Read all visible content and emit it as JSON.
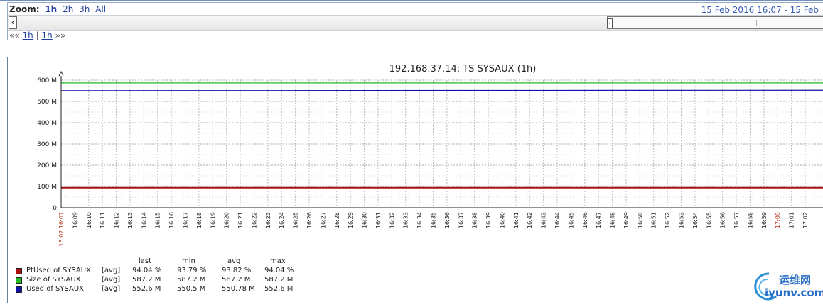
{
  "filter": {
    "zoom_label": "Zoom:",
    "zoom_options": [
      "1h",
      "2h",
      "3h",
      "All"
    ],
    "range_text": "15 Feb 2016 16:07  -  15 Feb",
    "nav_prev": "««",
    "nav_left": "1h",
    "nav_sep": "|",
    "nav_right": "1h",
    "nav_next": "»»",
    "scroll_left_glyph": "‹",
    "thumb_glyph": "‹",
    "thumb_grip": "|||"
  },
  "legend": {
    "headers": [
      "last",
      "min",
      "avg",
      "max"
    ],
    "rows": [
      {
        "name": "PtUsed of SYSAUX",
        "func": "[avg]",
        "last": "94.04 %",
        "min": "93.79 %",
        "avg": "93.82 %",
        "max": "94.04 %",
        "color": "#aa1111"
      },
      {
        "name": "Size of SYSAUX",
        "func": "[avg]",
        "last": "587.2 M",
        "min": "587.2 M",
        "avg": "587.2 M",
        "max": "587.2 M",
        "color": "#22bb22"
      },
      {
        "name": "Used of SYSAUX",
        "func": "[avg]",
        "last": "552.6 M",
        "min": "550.5 M",
        "avg": "550.78 M",
        "max": "552.6 M",
        "color": "#1111aa"
      }
    ]
  },
  "watermark": {
    "cn": "运维网",
    "en": "iyunv.com"
  },
  "chart_data": {
    "type": "line",
    "title": "192.168.37.14: TS SYSAUX (1h)",
    "xlabel": "",
    "ylabel": "",
    "ylim": [
      0,
      600
    ],
    "y_ticks": [
      0,
      100,
      200,
      300,
      400,
      500,
      600
    ],
    "y_tick_labels": [
      "0",
      "100 M",
      "200 M",
      "300 M",
      "400 M",
      "500 M",
      "600 M"
    ],
    "x_tick_labels": [
      "15.02 16:07",
      "16:09",
      "16:10",
      "16:11",
      "16:12",
      "16:13",
      "16:14",
      "16:15",
      "16:16",
      "16:17",
      "16:18",
      "16:19",
      "16:20",
      "16:21",
      "16:22",
      "16:23",
      "16:24",
      "16:25",
      "16:26",
      "16:27",
      "16:28",
      "16:29",
      "16:30",
      "16:31",
      "16:32",
      "16:33",
      "16:34",
      "16:35",
      "16:36",
      "16:37",
      "16:38",
      "16:39",
      "16:40",
      "16:41",
      "16:42",
      "16:43",
      "16:44",
      "16:45",
      "16:46",
      "16:47",
      "16:48",
      "16:49",
      "16:50",
      "16:51",
      "16:52",
      "16:53",
      "16:54",
      "16:55",
      "16:56",
      "16:57",
      "16:58",
      "16:59",
      "17:00",
      "17:01",
      "17:02"
    ],
    "x_tick_highlight": [
      "15.02 16:07",
      "17:00"
    ],
    "series": [
      {
        "name": "PtUsed of SYSAUX",
        "color": "#aa1111",
        "values": [
          94.04,
          94.04
        ]
      },
      {
        "name": "Size of SYSAUX",
        "color": "#22bb22",
        "values": [
          587.2,
          587.2
        ]
      },
      {
        "name": "Used of SYSAUX",
        "color": "#1111aa",
        "values": [
          550.5,
          552.6
        ]
      }
    ],
    "grid": true
  }
}
